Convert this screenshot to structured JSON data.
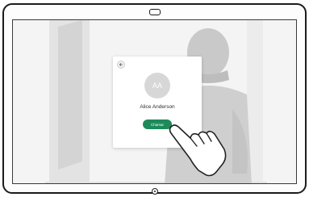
{
  "device": {
    "camera_icon": "camera-icon",
    "home_icon": "home-button-icon"
  },
  "contact_card": {
    "back_icon": "arrow-left-icon",
    "avatar_initials": "AA",
    "name": "Alice Anderson",
    "call_button_label": "Chamar",
    "accent_color": "#1e8a5a"
  },
  "gesture": {
    "icon": "tap-hand-icon"
  }
}
